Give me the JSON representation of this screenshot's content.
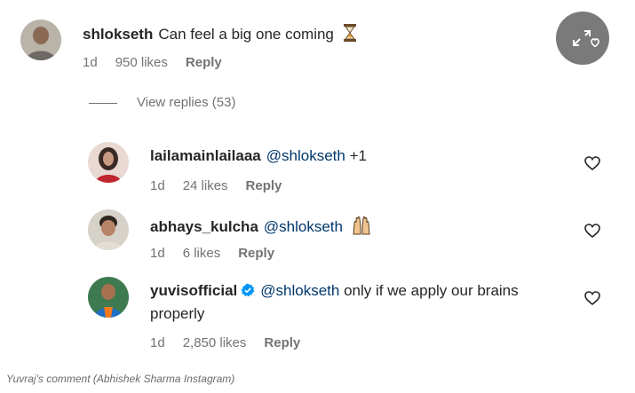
{
  "comments": [
    {
      "username": "shlokseth",
      "text": "Can feel a big one coming",
      "emoji_icon": "hourglass-icon",
      "age": "1d",
      "likes": "950 likes",
      "reply": "Reply"
    }
  ],
  "view_replies": "View replies (53)",
  "replies": [
    {
      "username": "lailamainlailaaa",
      "mention": "@shlokseth",
      "text": "+1",
      "age": "1d",
      "likes": "24 likes",
      "reply": "Reply"
    },
    {
      "username": "abhays_kulcha",
      "mention": "@shlokseth",
      "text": "",
      "emoji_icon": "raised-hands-icon",
      "age": "1d",
      "likes": "6 likes",
      "reply": "Reply"
    },
    {
      "username": "yuvisofficial",
      "verified": true,
      "mention": "@shlokseth",
      "text": "only if we apply our brains",
      "text_line2": "properly",
      "age": "1d",
      "likes": "2,850 likes",
      "reply": "Reply"
    }
  ],
  "caption": "Yuvraj's comment (Abhishek Sharma Instagram)",
  "colors": {
    "mention": "#00376b",
    "meta": "#737373",
    "verified": "#0095f6",
    "expand_button": "#7a7a7a"
  }
}
